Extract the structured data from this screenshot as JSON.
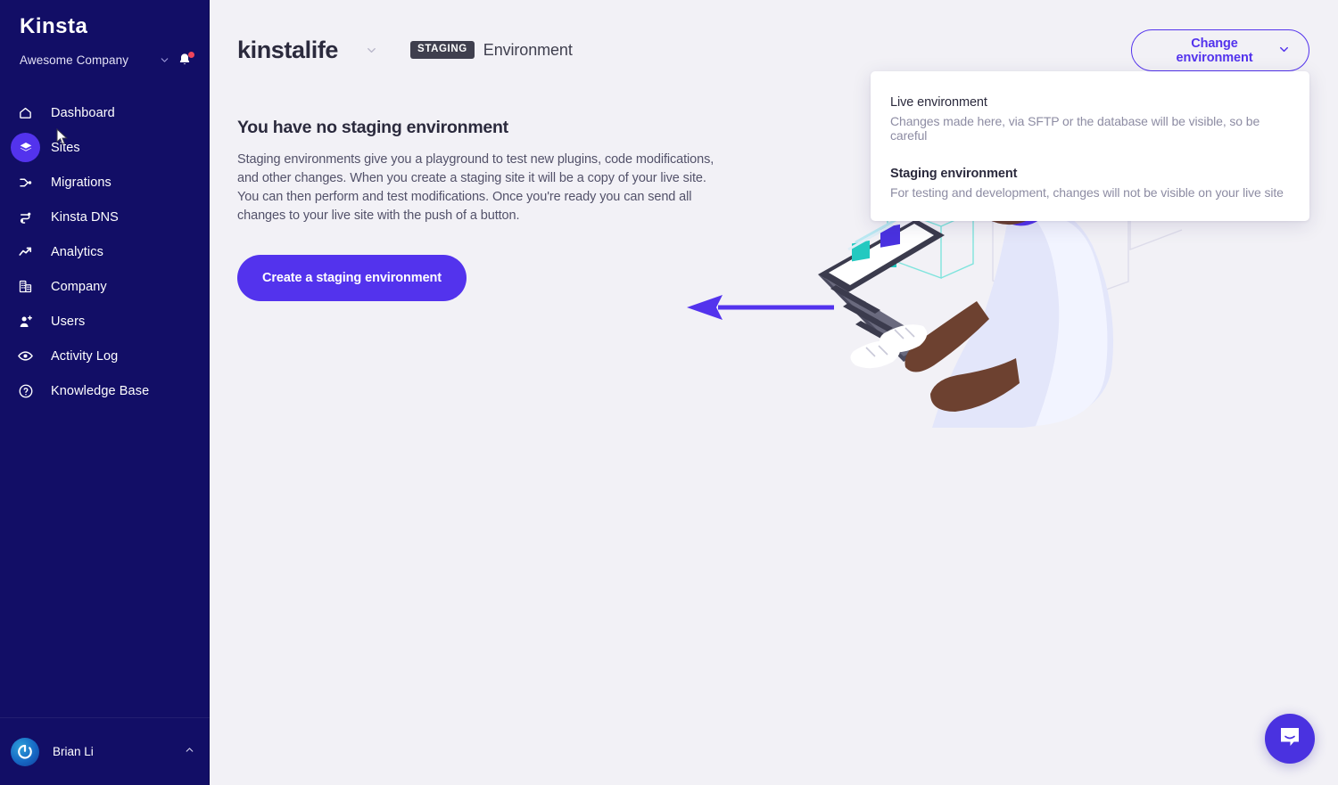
{
  "sidebar": {
    "logo": "Kinsta",
    "company": {
      "name": "Awesome Company",
      "chevron_icon": "chevron-down-icon",
      "bell_icon": "bell-icon",
      "has_notification": true
    },
    "items": [
      {
        "label": "Dashboard",
        "icon": "home-icon",
        "active": false
      },
      {
        "label": "Sites",
        "icon": "layers-icon",
        "active": true
      },
      {
        "label": "Migrations",
        "icon": "migrations-icon",
        "active": false
      },
      {
        "label": "Kinsta DNS",
        "icon": "dns-icon",
        "active": false
      },
      {
        "label": "Analytics",
        "icon": "analytics-icon",
        "active": false
      },
      {
        "label": "Company",
        "icon": "building-icon",
        "active": false
      },
      {
        "label": "Users",
        "icon": "user-plus-icon",
        "active": false
      },
      {
        "label": "Activity Log",
        "icon": "eye-icon",
        "active": false
      },
      {
        "label": "Knowledge Base",
        "icon": "question-circle-icon",
        "active": false
      }
    ],
    "user": {
      "name": "Brian Li",
      "avatar_icon": "user-avatar",
      "chevron_icon": "chevron-up-icon"
    }
  },
  "header": {
    "site_name": "kinstalife",
    "site_chevron_icon": "chevron-down-icon",
    "environment_badge": "STAGING",
    "environment_word": "Environment",
    "change_environment_label": "Change environment",
    "change_environment_chevron_icon": "chevron-down-icon"
  },
  "environment_dropdown": {
    "options": [
      {
        "title": "Live environment",
        "description": "Changes made here, via SFTP or the database will be visible, so be careful",
        "selected": false
      },
      {
        "title": "Staging environment",
        "description": "For testing and development, changes will not be visible on your live site",
        "selected": true
      }
    ]
  },
  "main": {
    "heading": "You have no staging environment",
    "body": "Staging environments give you a playground to test new plugins, code modifications, and other changes. When you create a staging site it will be a copy of your live site. You can then perform and test modifications. Once you're ready you can send all changes to your live site with the push of a button.",
    "cta_label": "Create a staging environment",
    "illustration_alt": "person-at-laptop-illustration"
  },
  "annotations": [
    {
      "name": "arrow-pointing-to-cta-button",
      "direction": "left"
    },
    {
      "name": "arrow-pointing-to-environment-dropdown",
      "direction": "right"
    }
  ],
  "support": {
    "chat_icon": "intercom-chat-icon"
  },
  "colors": {
    "sidebar_bg": "#120e66",
    "page_bg": "#f2f1f6",
    "accent": "#5333ed",
    "badge_bg": "#3f3f4e",
    "text_dark": "#2b2a3d",
    "text_muted": "#8d8ca3",
    "notification_dot": "#f0455b"
  }
}
